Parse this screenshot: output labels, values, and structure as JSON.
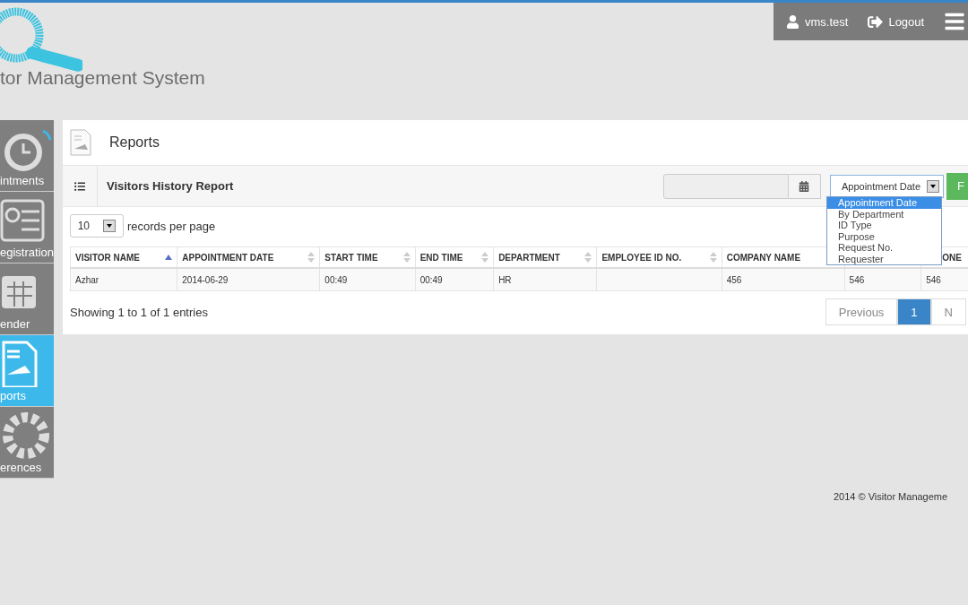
{
  "header": {
    "logo_text": "tor Management System",
    "user": "vms.test",
    "logout": "Logout"
  },
  "sidebar": {
    "items": [
      {
        "label": "intments",
        "kind": "clock",
        "selected": false
      },
      {
        "label": "egistration",
        "kind": "card",
        "selected": false
      },
      {
        "label": "ender",
        "kind": "calendar",
        "selected": false
      },
      {
        "label": "ports",
        "kind": "report",
        "selected": true
      },
      {
        "label": "erences",
        "kind": "gear",
        "selected": false
      }
    ]
  },
  "page": {
    "title": "Reports"
  },
  "report": {
    "title": "Visitors History Report",
    "filter_select": "Appointment Date",
    "filter_button": "F",
    "filter_options": [
      {
        "label": "Appointment Date",
        "selected": true
      },
      {
        "label": "By Department",
        "selected": false
      },
      {
        "label": "ID Type",
        "selected": false
      },
      {
        "label": "Purpose",
        "selected": false
      },
      {
        "label": "Request No.",
        "selected": false
      },
      {
        "label": "Requester",
        "selected": false
      }
    ],
    "page_size": "10",
    "page_size_label": "records per page"
  },
  "table": {
    "columns": [
      {
        "label": "VISITOR NAME",
        "sorted": true
      },
      {
        "label": "APPOINTMENT DATE",
        "sorted": false
      },
      {
        "label": "START TIME",
        "sorted": false
      },
      {
        "label": "END TIME",
        "sorted": false
      },
      {
        "label": "DEPARTMENT",
        "sorted": false
      },
      {
        "label": "EMPLOYEE ID NO.",
        "sorted": false
      },
      {
        "label": "COMPANY NAME"
      },
      {},
      {
        "label": "ONE"
      }
    ],
    "rows": [
      [
        "Azhar",
        "2014-06-29",
        "00:49",
        "00:49",
        "HR",
        "",
        "456",
        "546",
        "546"
      ]
    ]
  },
  "info": "Showing 1 to 1 of 1 entries",
  "pagination": [
    {
      "label": "Previous",
      "selected": false
    },
    {
      "label": "1",
      "selected": true
    },
    {
      "label": "N",
      "selected": false
    }
  ],
  "footer": "2014 © Visitor Manageme"
}
